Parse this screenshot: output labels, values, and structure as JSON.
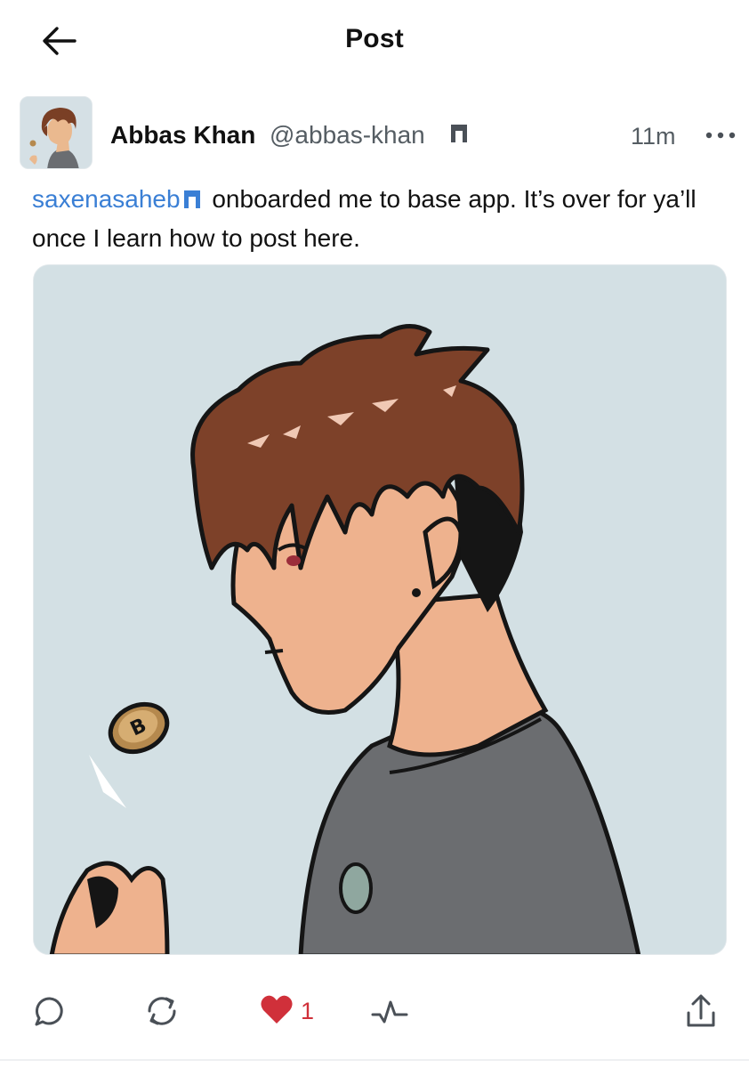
{
  "header": {
    "title": "Post",
    "back_icon": "arrow-left-icon"
  },
  "post": {
    "author": {
      "name": "Abbas Khan",
      "handle": "@abbas-khan",
      "badge_icon": "base-badge-icon"
    },
    "timestamp": "11m",
    "more_icon": "more-horizontal-icon",
    "mention": "saxenasaheb",
    "text": "onboarded me to base app. It’s over for ya’ll once I learn how to post here.",
    "media": {
      "description_icon": "anime-character-illustration",
      "background_color": "#d3e0e4"
    }
  },
  "actions": {
    "reply_icon": "comment-icon",
    "recast_icon": "repost-icon",
    "like_icon": "heart-icon",
    "like_count": "1",
    "like_color": "#d0303a",
    "activity_icon": "activity-icon",
    "share_icon": "share-icon"
  },
  "colors": {
    "accent": "#3a7fd5",
    "muted": "#555d63"
  }
}
